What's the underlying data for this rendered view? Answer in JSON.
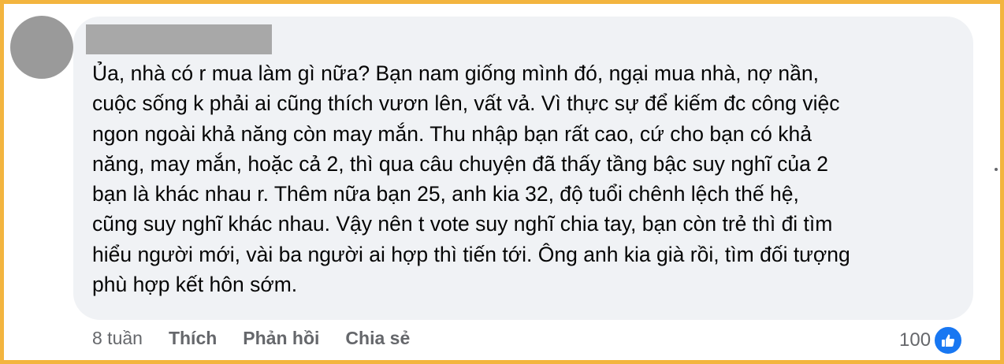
{
  "comment": {
    "lines": [
      "Ủa, nhà có r mua làm gì nữa? Bạn nam giống mình đó, ngại mua nhà, nợ nần,",
      "cuộc sống k phải ai cũng thích vươn lên, vất vả. Vì thực sự để kiếm đc công việc",
      "ngon ngoài khả năng còn may mắn. Thu nhập bạn rất cao, cứ cho bạn có khả",
      "năng, may mắn, hoặc cả 2, thì qua câu chuyện đã thấy tầng bậc suy nghĩ của 2",
      "bạn là khác nhau r. Thêm nữa bạn 25, anh kia 32, độ tuổi chênh lệch thế hệ,",
      "cũng suy nghĩ khác nhau. Vậy nên t vote suy nghĩ chia tay, bạn còn trẻ thì đi tìm",
      "hiểu người mới, vài ba người ai hợp thì tiến tới. Ông anh kia già rồi, tìm đối tượng",
      "phù hợp kết hôn sớm."
    ]
  },
  "actions": {
    "time": "8 tuần",
    "like": "Thích",
    "reply": "Phản hồi",
    "share": "Chia sẻ"
  },
  "reactions": {
    "count": "100",
    "icon": "thumbs-up-icon",
    "color": "#1877f2"
  },
  "colors": {
    "border": "#f3b53f",
    "bubble": "#f0f2f5",
    "meta_text": "#65676b"
  }
}
